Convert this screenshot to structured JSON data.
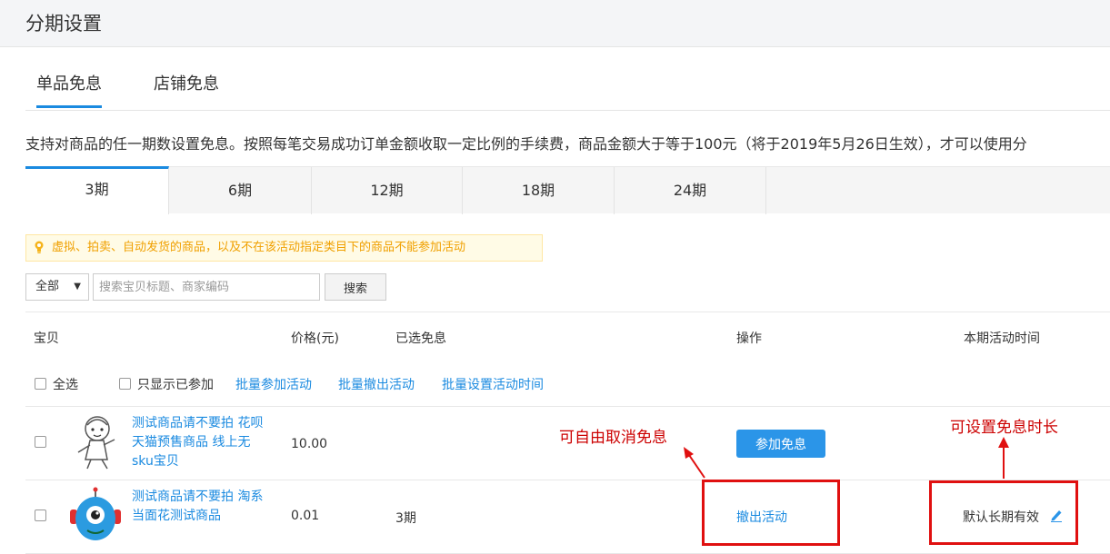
{
  "page": {
    "title": "分期设置"
  },
  "main_tabs": [
    {
      "label": "单品免息",
      "active": true
    },
    {
      "label": "店铺免息",
      "active": false
    }
  ],
  "description": "支持对商品的任一期数设置免息。按照每笔交易成功订单金额收取一定比例的手续费，商品金额大于等于100元（将于2019年5月26日生效），才可以使用分",
  "period_tabs": [
    {
      "label": "3期",
      "active": true
    },
    {
      "label": "6期",
      "active": false
    },
    {
      "label": "12期",
      "active": false
    },
    {
      "label": "18期",
      "active": false
    },
    {
      "label": "24期",
      "active": false
    }
  ],
  "tip": {
    "text": "虚拟、拍卖、自动发货的商品，以及不在该活动指定类目下的商品不能参加活动",
    "icon": "lightbulb-icon",
    "color": "#f0a000"
  },
  "filter": {
    "select_value": "全部",
    "search_placeholder": "搜索宝贝标题、商家编码",
    "search_button": "搜索"
  },
  "table": {
    "headers": {
      "item": "宝贝",
      "price": "价格(元)",
      "chosen": "已选免息",
      "action": "操作",
      "time": "本期活动时间"
    },
    "batch": {
      "select_all": "全选",
      "only_joined": "只显示已参加",
      "batch_join": "批量参加活动",
      "batch_withdraw": "批量撤出活动",
      "batch_set_time": "批量设置活动时间"
    },
    "rows": [
      {
        "name": "测试商品请不要拍 花呗天猫预售商品 线上无sku宝贝",
        "price": "10.00",
        "chosen": "",
        "action_button": "参加免息",
        "time": ""
      },
      {
        "name": "测试商品请不要拍 淘系当面花测试商品",
        "price": "0.01",
        "chosen": "3期",
        "action_link": "撤出活动",
        "time": "默认长期有效"
      }
    ]
  },
  "annotations": {
    "cancel_note": "可自由取消免息",
    "duration_note": "可设置免息时长",
    "color": "#e01010"
  },
  "colors": {
    "accent": "#1a8ae0",
    "button": "#2b95e8"
  }
}
